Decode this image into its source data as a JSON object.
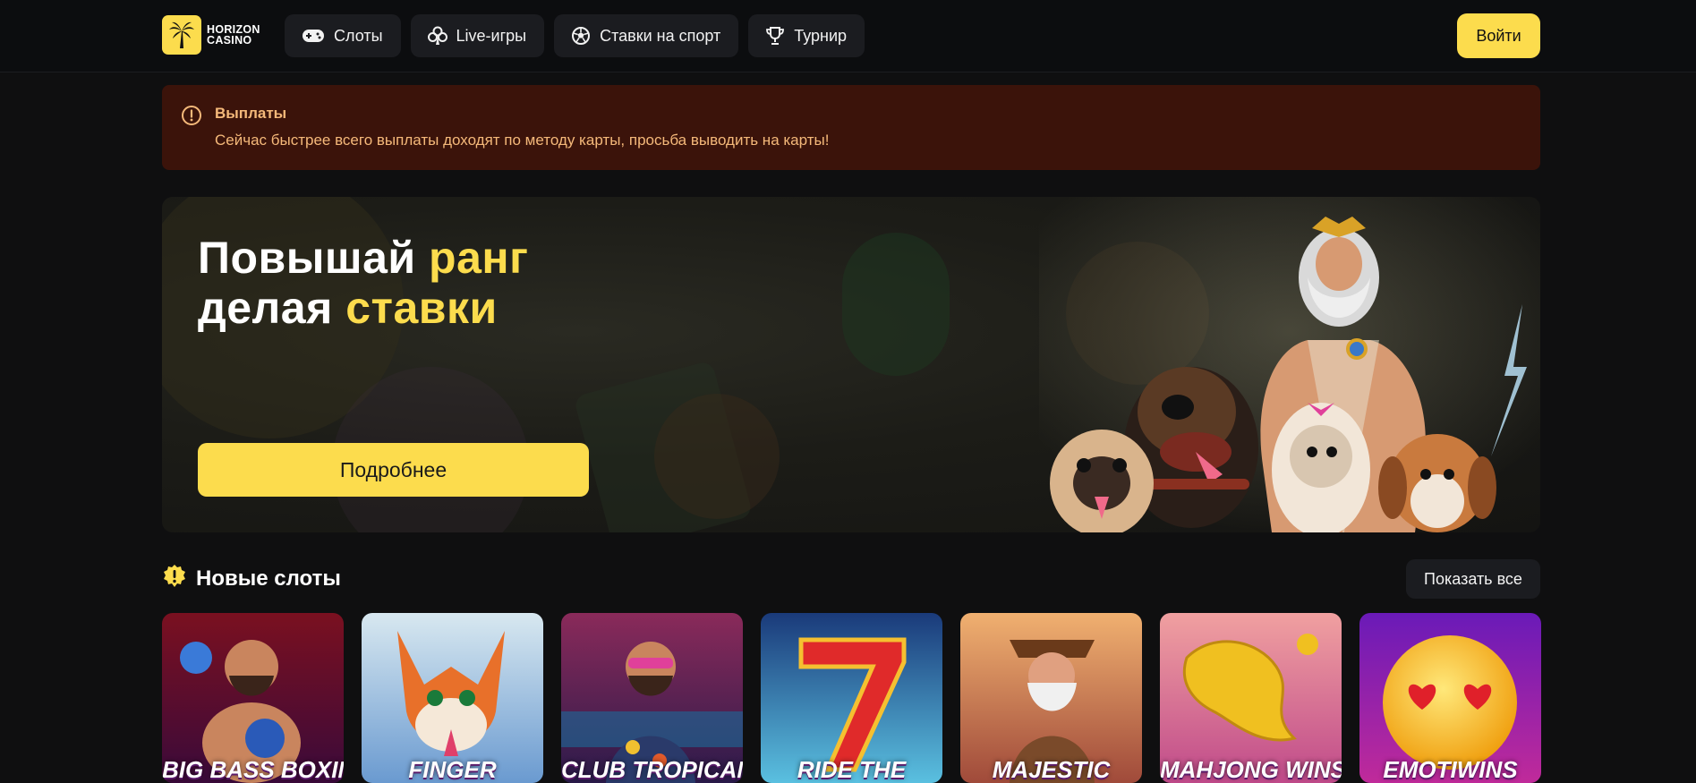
{
  "header": {
    "logo_line1": "HORIZON",
    "logo_line2": "CASINO",
    "nav": [
      {
        "label": "Слоты",
        "icon": "gamepad-icon"
      },
      {
        "label": "Live-игры",
        "icon": "club-icon"
      },
      {
        "label": "Ставки на спорт",
        "icon": "soccer-ball-icon"
      },
      {
        "label": "Турнир",
        "icon": "trophy-icon"
      }
    ],
    "login_label": "Войти"
  },
  "alert": {
    "title": "Выплаты",
    "text": "Сейчас быстрее всего выплаты доходят по методу карты, просьба выводить на карты!",
    "icon": "alert-circle-icon"
  },
  "hero": {
    "line1_white": "Повышай ",
    "line1_accent": "ранг",
    "line2_white": "делая ",
    "line2_accent": "ставки",
    "button_label": "Подробнее"
  },
  "new_slots": {
    "title": "Новые слоты",
    "show_all_label": "Показать все",
    "items": [
      {
        "title": "BIG BASS BOXING"
      },
      {
        "title": "FINGER"
      },
      {
        "title": "CLUB TROPICANA"
      },
      {
        "title": "RIDE THE"
      },
      {
        "title": "MAJESTIC"
      },
      {
        "title": "MAHJONG WINS"
      },
      {
        "title": "EMOTIWINS"
      }
    ]
  },
  "colors": {
    "accent": "#fcdc4d",
    "background": "#0f0f10",
    "alert_bg": "#3b130a",
    "alert_text": "#f5b97a"
  }
}
